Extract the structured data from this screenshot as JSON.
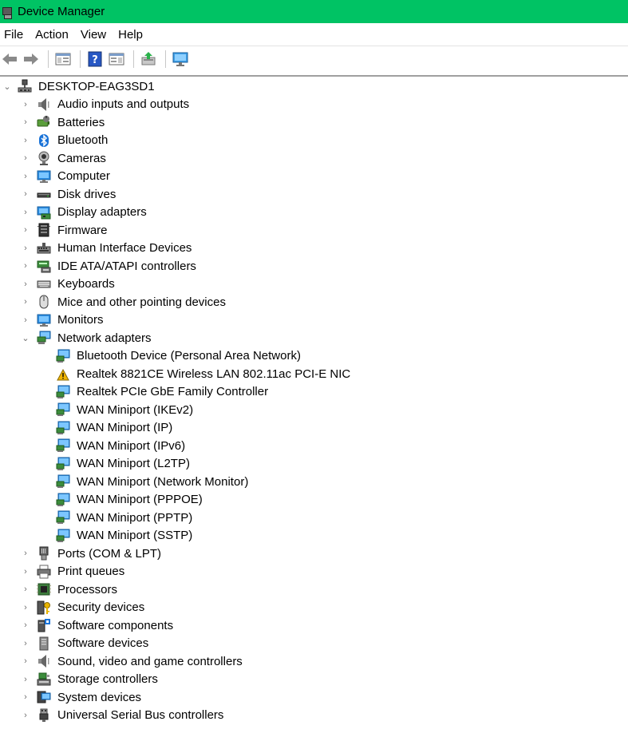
{
  "window": {
    "title": "Device Manager"
  },
  "menu": {
    "file": "File",
    "action": "Action",
    "view": "View",
    "help": "Help"
  },
  "tree": {
    "root": "DESKTOP-EAG3SD1",
    "categories": [
      {
        "label": "Audio inputs and outputs",
        "icon": "speaker-icon"
      },
      {
        "label": "Batteries",
        "icon": "battery-icon"
      },
      {
        "label": "Bluetooth",
        "icon": "bluetooth-icon"
      },
      {
        "label": "Cameras",
        "icon": "camera-icon"
      },
      {
        "label": "Computer",
        "icon": "computer-icon"
      },
      {
        "label": "Disk drives",
        "icon": "disk-drive-icon"
      },
      {
        "label": "Display adapters",
        "icon": "display-adapter-icon"
      },
      {
        "label": "Firmware",
        "icon": "firmware-icon"
      },
      {
        "label": "Human Interface Devices",
        "icon": "hid-icon"
      },
      {
        "label": "IDE ATA/ATAPI controllers",
        "icon": "ide-controller-icon"
      },
      {
        "label": "Keyboards",
        "icon": "keyboard-icon"
      },
      {
        "label": "Mice and other pointing devices",
        "icon": "mouse-icon"
      },
      {
        "label": "Monitors",
        "icon": "monitor-icon"
      },
      {
        "label": "Network adapters",
        "icon": "network-adapter-icon",
        "expanded": true
      }
    ],
    "network_devices": [
      {
        "label": "Bluetooth Device (Personal Area Network)",
        "warning": false
      },
      {
        "label": "Realtek 8821CE Wireless LAN 802.11ac PCI-E NIC",
        "warning": true
      },
      {
        "label": "Realtek PCIe GbE Family Controller",
        "warning": false
      },
      {
        "label": "WAN Miniport (IKEv2)",
        "warning": false
      },
      {
        "label": "WAN Miniport (IP)",
        "warning": false
      },
      {
        "label": "WAN Miniport (IPv6)",
        "warning": false
      },
      {
        "label": "WAN Miniport (L2TP)",
        "warning": false
      },
      {
        "label": "WAN Miniport (Network Monitor)",
        "warning": false
      },
      {
        "label": "WAN Miniport (PPPOE)",
        "warning": false
      },
      {
        "label": "WAN Miniport (PPTP)",
        "warning": false
      },
      {
        "label": "WAN Miniport (SSTP)",
        "warning": false
      }
    ],
    "categories_after": [
      {
        "label": "Ports (COM & LPT)",
        "icon": "port-icon"
      },
      {
        "label": "Print queues",
        "icon": "printer-icon"
      },
      {
        "label": "Processors",
        "icon": "processor-icon"
      },
      {
        "label": "Security devices",
        "icon": "security-key-icon"
      },
      {
        "label": "Software components",
        "icon": "software-component-icon"
      },
      {
        "label": "Software devices",
        "icon": "software-device-icon"
      },
      {
        "label": "Sound, video and game controllers",
        "icon": "speaker-icon"
      },
      {
        "label": "Storage controllers",
        "icon": "storage-controller-icon"
      },
      {
        "label": "System devices",
        "icon": "system-device-icon"
      },
      {
        "label": "Universal Serial Bus controllers",
        "icon": "usb-icon"
      }
    ]
  },
  "colors": {
    "titlebar": "#00c364",
    "accent": "#1a73d8",
    "warning": "#f0b400"
  }
}
